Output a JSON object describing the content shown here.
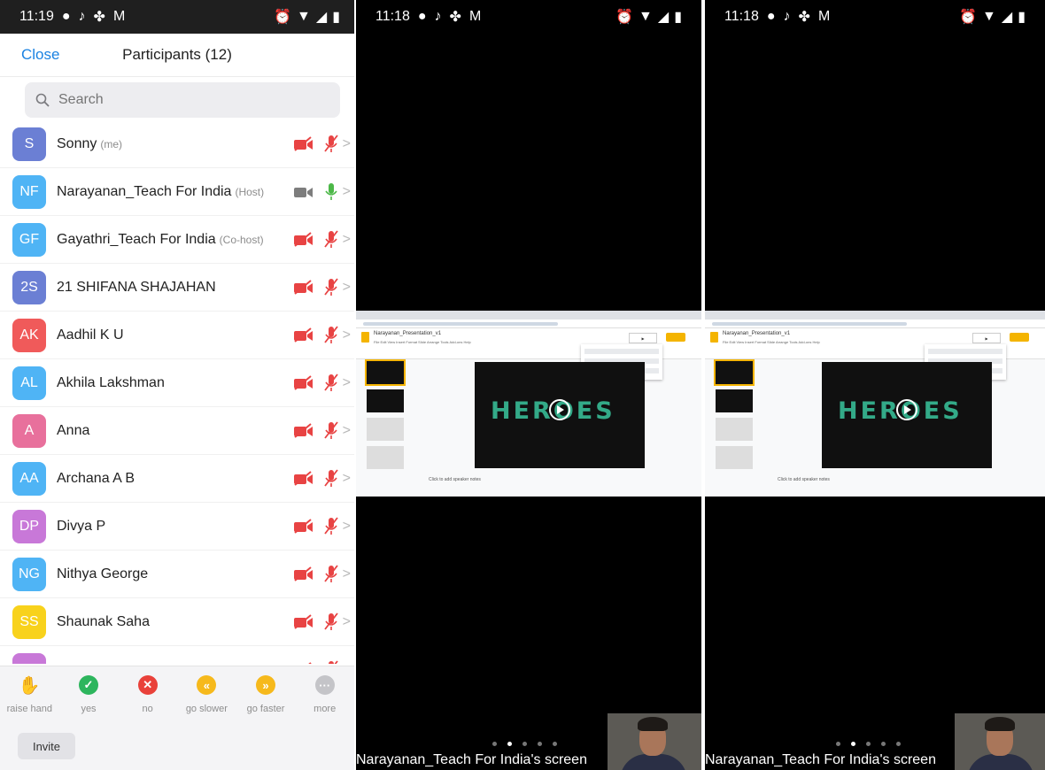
{
  "participants_screen": {
    "status_time": "11:19",
    "close_label": "Close",
    "title": "Participants (12)",
    "search_placeholder": "Search",
    "participants": [
      {
        "initials": "S",
        "name": "Sonny",
        "role": "(me)",
        "color": "#6b7fd4",
        "video": "off",
        "audio": "muted"
      },
      {
        "initials": "NF",
        "name": "Narayanan_Teach For India",
        "role": "(Host)",
        "color": "#4fb4f5",
        "video": "on",
        "audio": "on"
      },
      {
        "initials": "GF",
        "name": "Gayathri_Teach For India",
        "role": "(Co-host)",
        "color": "#4fb4f5",
        "video": "off",
        "audio": "muted"
      },
      {
        "initials": "2S",
        "name": "21 SHIFANA SHAJAHAN",
        "role": "",
        "color": "#6b7fd4",
        "video": "off",
        "audio": "muted"
      },
      {
        "initials": "AK",
        "name": "Aadhil K U",
        "role": "",
        "color": "#f05a5a",
        "video": "off",
        "audio": "muted"
      },
      {
        "initials": "AL",
        "name": "Akhila Lakshman",
        "role": "",
        "color": "#4fb4f5",
        "video": "off",
        "audio": "muted"
      },
      {
        "initials": "A",
        "name": "Anna",
        "role": "",
        "color": "#e8709c",
        "video": "off",
        "audio": "muted"
      },
      {
        "initials": "AA",
        "name": "Archana A B",
        "role": "",
        "color": "#4fb4f5",
        "video": "off",
        "audio": "muted"
      },
      {
        "initials": "DP",
        "name": "Divya P",
        "role": "",
        "color": "#c878d8",
        "video": "off",
        "audio": "muted"
      },
      {
        "initials": "NG",
        "name": "Nithya George",
        "role": "",
        "color": "#4fb4f5",
        "video": "off",
        "audio": "muted"
      },
      {
        "initials": "SS",
        "name": "Shaunak Saha",
        "role": "",
        "color": "#f8d21c",
        "video": "off",
        "audio": "muted"
      },
      {
        "initials": "",
        "name": "",
        "role": "",
        "color": "#c878d8",
        "video": "off",
        "audio": "muted"
      }
    ],
    "reactions": [
      {
        "label": "raise hand",
        "icon": "hand-icon",
        "color": "#2f6fe8",
        "glyph": "✋"
      },
      {
        "label": "yes",
        "icon": "check-icon",
        "color": "#2db55d",
        "glyph": "✓"
      },
      {
        "label": "no",
        "icon": "x-icon",
        "color": "#e9413a",
        "glyph": "✕"
      },
      {
        "label": "go slower",
        "icon": "rewind-icon",
        "color": "#f6b91c",
        "glyph": "«"
      },
      {
        "label": "go faster",
        "icon": "fast-forward-icon",
        "color": "#f6b91c",
        "glyph": "»"
      },
      {
        "label": "more",
        "icon": "more-icon",
        "color": "#c4c4c8",
        "glyph": "···"
      }
    ],
    "invite_label": "Invite"
  },
  "share_screens": [
    {
      "status_time": "11:18",
      "caption": "Narayanan_Teach For India's screen",
      "presentation_title": "Narayanan_Presentation_v1",
      "slide_text": "HEROES",
      "notes_text": "Click to add speaker notes",
      "active_page_dot": 1
    },
    {
      "status_time": "11:18",
      "caption": "Narayanan_Teach For India's screen",
      "presentation_title": "Narayanan_Presentation_v1",
      "slide_text": "HEROES",
      "notes_text": "Click to add speaker notes",
      "active_page_dot": 1
    }
  ],
  "colors": {
    "accent_blue": "#1a82e2",
    "muted_red": "#e84343",
    "audio_green": "#4cb848"
  }
}
